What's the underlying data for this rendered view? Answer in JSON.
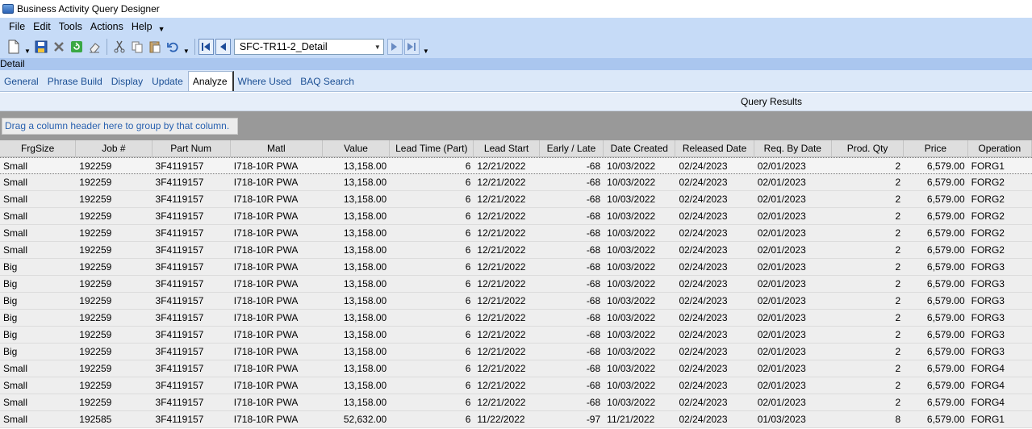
{
  "window": {
    "title": "Business Activity Query Designer"
  },
  "menu": {
    "items": [
      "File",
      "Edit",
      "Tools",
      "Actions",
      "Help"
    ]
  },
  "toolbar": {
    "query_name": "SFC-TR11-2_Detail"
  },
  "detail_label": "Detail",
  "tabs": [
    "General",
    "Phrase Build",
    "Display",
    "Update",
    "Analyze",
    "Where Used",
    "BAQ Search"
  ],
  "active_tab": "Analyze",
  "results": {
    "header": "Query Results",
    "group_hint": "Drag a column header here to group by that column.",
    "columns": [
      "FrgSize",
      "Job #",
      "Part Num",
      "Matl",
      "Value",
      "Lead Time (Part)",
      "Lead Start",
      "Early / Late",
      "Date Created",
      "Released Date",
      "Req. By Date",
      "Prod. Qty",
      "Price",
      "Operation"
    ],
    "rows": [
      [
        "Small",
        "192259",
        "3F4119157",
        "I718-10R PWA",
        "13,158.00",
        "6",
        "12/21/2022",
        "-68",
        "10/03/2022",
        "02/24/2023",
        "02/01/2023",
        "2",
        "6,579.00",
        "FORG1"
      ],
      [
        "Small",
        "192259",
        "3F4119157",
        "I718-10R PWA",
        "13,158.00",
        "6",
        "12/21/2022",
        "-68",
        "10/03/2022",
        "02/24/2023",
        "02/01/2023",
        "2",
        "6,579.00",
        "FORG2"
      ],
      [
        "Small",
        "192259",
        "3F4119157",
        "I718-10R PWA",
        "13,158.00",
        "6",
        "12/21/2022",
        "-68",
        "10/03/2022",
        "02/24/2023",
        "02/01/2023",
        "2",
        "6,579.00",
        "FORG2"
      ],
      [
        "Small",
        "192259",
        "3F4119157",
        "I718-10R PWA",
        "13,158.00",
        "6",
        "12/21/2022",
        "-68",
        "10/03/2022",
        "02/24/2023",
        "02/01/2023",
        "2",
        "6,579.00",
        "FORG2"
      ],
      [
        "Small",
        "192259",
        "3F4119157",
        "I718-10R PWA",
        "13,158.00",
        "6",
        "12/21/2022",
        "-68",
        "10/03/2022",
        "02/24/2023",
        "02/01/2023",
        "2",
        "6,579.00",
        "FORG2"
      ],
      [
        "Small",
        "192259",
        "3F4119157",
        "I718-10R PWA",
        "13,158.00",
        "6",
        "12/21/2022",
        "-68",
        "10/03/2022",
        "02/24/2023",
        "02/01/2023",
        "2",
        "6,579.00",
        "FORG2"
      ],
      [
        "Big",
        "192259",
        "3F4119157",
        "I718-10R PWA",
        "13,158.00",
        "6",
        "12/21/2022",
        "-68",
        "10/03/2022",
        "02/24/2023",
        "02/01/2023",
        "2",
        "6,579.00",
        "FORG3"
      ],
      [
        "Big",
        "192259",
        "3F4119157",
        "I718-10R PWA",
        "13,158.00",
        "6",
        "12/21/2022",
        "-68",
        "10/03/2022",
        "02/24/2023",
        "02/01/2023",
        "2",
        "6,579.00",
        "FORG3"
      ],
      [
        "Big",
        "192259",
        "3F4119157",
        "I718-10R PWA",
        "13,158.00",
        "6",
        "12/21/2022",
        "-68",
        "10/03/2022",
        "02/24/2023",
        "02/01/2023",
        "2",
        "6,579.00",
        "FORG3"
      ],
      [
        "Big",
        "192259",
        "3F4119157",
        "I718-10R PWA",
        "13,158.00",
        "6",
        "12/21/2022",
        "-68",
        "10/03/2022",
        "02/24/2023",
        "02/01/2023",
        "2",
        "6,579.00",
        "FORG3"
      ],
      [
        "Big",
        "192259",
        "3F4119157",
        "I718-10R PWA",
        "13,158.00",
        "6",
        "12/21/2022",
        "-68",
        "10/03/2022",
        "02/24/2023",
        "02/01/2023",
        "2",
        "6,579.00",
        "FORG3"
      ],
      [
        "Big",
        "192259",
        "3F4119157",
        "I718-10R PWA",
        "13,158.00",
        "6",
        "12/21/2022",
        "-68",
        "10/03/2022",
        "02/24/2023",
        "02/01/2023",
        "2",
        "6,579.00",
        "FORG3"
      ],
      [
        "Small",
        "192259",
        "3F4119157",
        "I718-10R PWA",
        "13,158.00",
        "6",
        "12/21/2022",
        "-68",
        "10/03/2022",
        "02/24/2023",
        "02/01/2023",
        "2",
        "6,579.00",
        "FORG4"
      ],
      [
        "Small",
        "192259",
        "3F4119157",
        "I718-10R PWA",
        "13,158.00",
        "6",
        "12/21/2022",
        "-68",
        "10/03/2022",
        "02/24/2023",
        "02/01/2023",
        "2",
        "6,579.00",
        "FORG4"
      ],
      [
        "Small",
        "192259",
        "3F4119157",
        "I718-10R PWA",
        "13,158.00",
        "6",
        "12/21/2022",
        "-68",
        "10/03/2022",
        "02/24/2023",
        "02/01/2023",
        "2",
        "6,579.00",
        "FORG4"
      ],
      [
        "Small",
        "192585",
        "3F4119157",
        "I718-10R PWA",
        "52,632.00",
        "6",
        "11/22/2022",
        "-97",
        "11/21/2022",
        "02/24/2023",
        "01/03/2023",
        "8",
        "6,579.00",
        "FORG1"
      ]
    ]
  },
  "icons": [
    "app-icon",
    "new-icon",
    "save-icon",
    "delete-icon",
    "refresh-icon",
    "eraser-icon",
    "cut-icon",
    "copy-icon",
    "paste-icon",
    "undo-icon",
    "first-record-icon",
    "previous-record-icon",
    "next-record-icon",
    "last-record-icon"
  ]
}
